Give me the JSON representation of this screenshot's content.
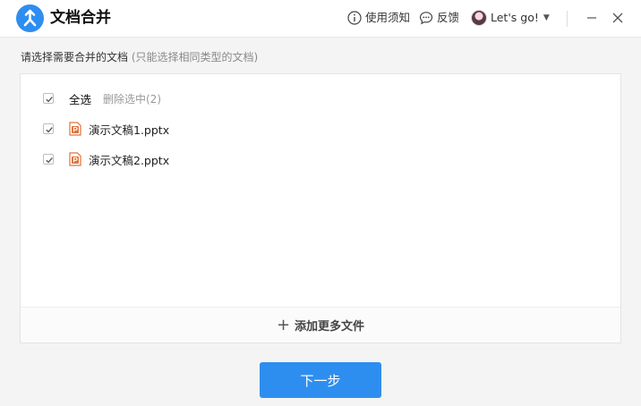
{
  "app": {
    "title": "文档合并",
    "logo_icon": "merge-arrow-icon",
    "accent": "#2e8ef0"
  },
  "header": {
    "help_label": "使用须知",
    "feedback_label": "反馈",
    "user_name": "Let's go!"
  },
  "main": {
    "instruction": "请选择需要合并的文档",
    "instruction_hint": "(只能选择相同类型的文档)",
    "select_all_label": "全选",
    "delete_selected_label": "删除选中(2)",
    "files": [
      {
        "name": "演示文稿1.pptx",
        "checked": true,
        "icon": "pptx-file-icon"
      },
      {
        "name": "演示文稿2.pptx",
        "checked": true,
        "icon": "pptx-file-icon"
      }
    ],
    "add_more_label": "添加更多文件"
  },
  "footer": {
    "next_label": "下一步"
  }
}
